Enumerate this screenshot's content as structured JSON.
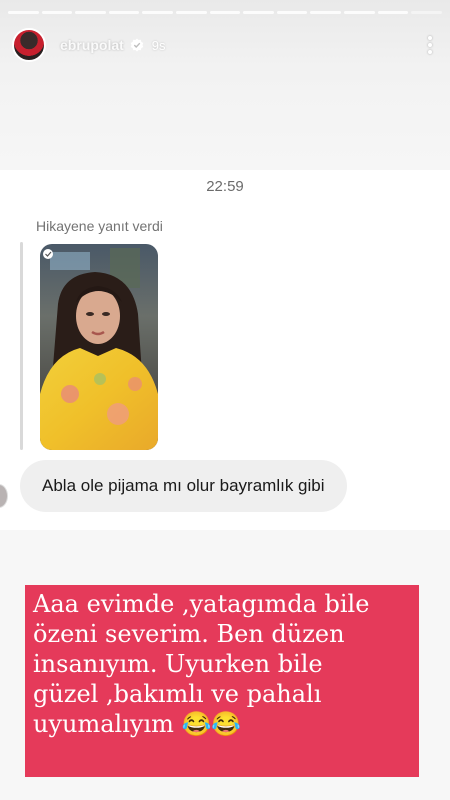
{
  "header": {
    "username": "ebrupolat",
    "time_ago": "9s",
    "verified_icon": "verified-badge-icon",
    "more_icon": "more-vertical-icon"
  },
  "progress": {
    "segments": 13
  },
  "chat": {
    "time": "22:59",
    "reply_label": "Hikayene yanıt verdi",
    "message": "Abla ole pijama mı olur bayramlık gibi"
  },
  "caption": {
    "text": "Aaa evimde ,yatagımda bile\nözeni severim. Ben düzen\ninsanıyım. Uyurken bile\ngüzel ,bakımlı ve pahalı\nuyumalıyım 😂😂",
    "background": "#e53a5a"
  }
}
